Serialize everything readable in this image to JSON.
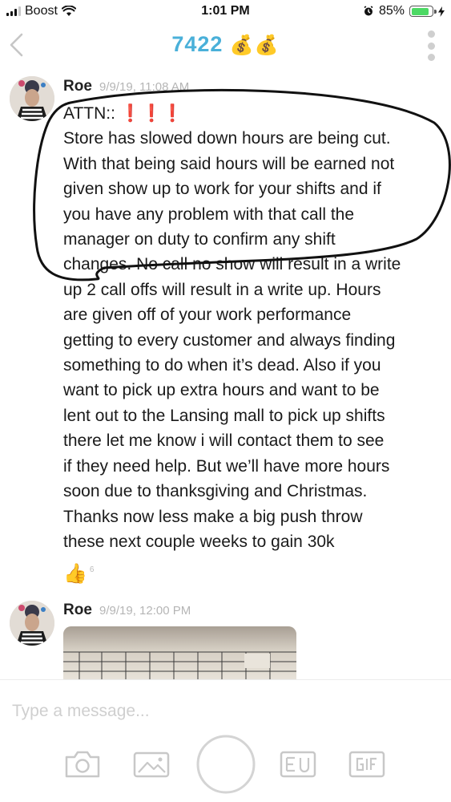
{
  "status_bar": {
    "carrier": "Boost",
    "time": "1:01 PM",
    "battery_percent": "85%",
    "battery_level": 0.85,
    "icons": [
      "signal-icon",
      "wifi-icon",
      "alarm-icon",
      "battery-icon",
      "charging-bolt-icon"
    ]
  },
  "header": {
    "title": "7422",
    "title_emoji": "💰💰",
    "icons": [
      "back-chevron-icon",
      "more-dots-icon"
    ]
  },
  "messages": [
    {
      "author": "Roe",
      "timestamp": "9/9/19, 11:08 AM",
      "attn": "ATTN::",
      "attn_marks": "❗❗❗",
      "lines": [
        "Store has slowed down hours are being cut.",
        "With that being said hours will be earned not",
        "given show up to work for your shifts and if",
        "you have any problem with that call the",
        "manager on duty to confirm any shift",
        "changes. No call no show will result in a write",
        "up 2 call offs will result in a write up. Hours",
        "are given off of your work performance",
        "getting to every customer and always finding",
        "something to do when it’s dead. Also if you",
        "want to pick up extra hours and want to be",
        "lent out to the Lansing mall to pick up shifts",
        "there let me know i will contact them to see",
        "if they need help. But we’ll have more hours",
        "soon due to thanksgiving and Christmas.",
        "Thanks now less make a big push throw",
        "these next couple weeks to gain 30k"
      ],
      "reaction": {
        "emoji": "👍",
        "count": "6"
      }
    },
    {
      "author": "Roe",
      "timestamp": "9/9/19, 12:00 PM",
      "attachment": "photo"
    }
  ],
  "composer": {
    "placeholder": "Type a message...",
    "tools": [
      "camera-icon",
      "gallery-icon",
      "shutter-button",
      "text-card-icon",
      "gif-icon"
    ]
  },
  "colors": {
    "title": "#4ab0d9",
    "timestamp": "#b5b5b5",
    "placeholder": "#cfcfcf",
    "attn_marks": "#e8262b",
    "battery": "#4cd964"
  }
}
